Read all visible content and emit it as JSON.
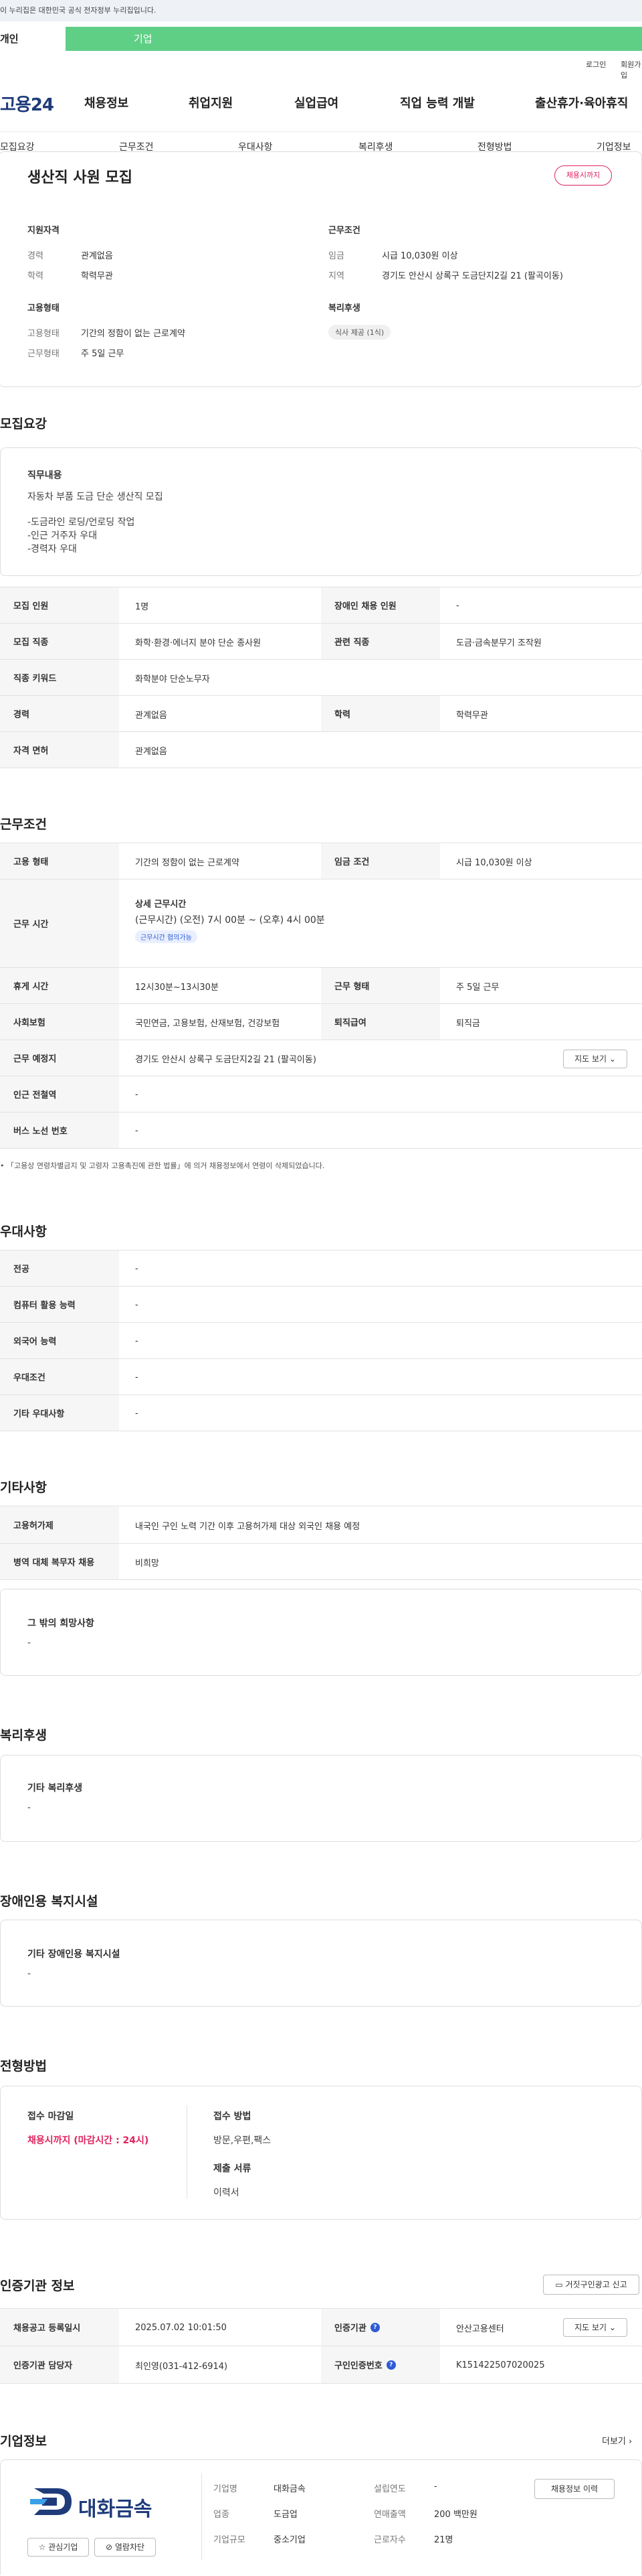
{
  "gov_bar": {
    "text": "이 누리집은 대한민국 공식 전자정부 누리집입니다."
  },
  "user_tabs": {
    "individual": "개인",
    "corporate": "기업"
  },
  "util": {
    "login": "로그인",
    "signup": "회원가입"
  },
  "gnb": {
    "logo": "고용24",
    "items": [
      "채용정보",
      "취업지원",
      "실업급여",
      "직업 능력 개발",
      "출산휴가·육아휴직",
      "기업정보"
    ]
  },
  "anchors": [
    "모집요강",
    "근무조건",
    "우대사항",
    "복리후생",
    "전형방법",
    "기업정보"
  ],
  "summary": {
    "title": "생산직 사원 모집",
    "deadline_badge": "채용시까지",
    "qual_head": "지원자격",
    "career_k": "경력",
    "career_v": "관계없음",
    "edu_k": "학력",
    "edu_v": "학력무관",
    "emp_head": "고용형태",
    "emptype_k": "고용형태",
    "emptype_v": "기간의 정함이 없는 근로계약",
    "worktype_k": "근무형태",
    "worktype_v": "주 5일 근무",
    "cond_head": "근무조건",
    "wage_k": "임금",
    "wage_v": "시급 10,030원 이상",
    "region_k": "지역",
    "region_v": "경기도 안산시 상록구 도금단지2길 21 (팔곡이동)",
    "welfare_head": "복리후생",
    "welfare_chip": "식사 제공 (1식)"
  },
  "recruit": {
    "heading": "모집요강",
    "duty_head": "직무내용",
    "duty_lines": [
      "자동차 부품 도금 단순 생산직 모집",
      "",
      "-도금라인 로딩/언로딩 작업",
      "-인근 거주자 우대",
      "-경력자 우대"
    ],
    "rows": {
      "headcount_k": "모집 인원",
      "headcount_v": "1명",
      "disabled_k": "장애인 채용 인원",
      "disabled_v": "-",
      "jobcat_k": "모집 직종",
      "jobcat_v": "화학·환경·에너지 분야 단순 종사원",
      "related_k": "관련 직종",
      "related_v": "도금·금속분무기 조작원",
      "keyword_k": "직종 키워드",
      "keyword_v": "화학분야 단순노무자",
      "career_k": "경력",
      "career_v": "관계없음",
      "edu_k": "학력",
      "edu_v": "학력무관",
      "license_k": "자격 면허",
      "license_v": "관계없음"
    }
  },
  "work": {
    "heading": "근무조건",
    "emptype_k": "고용 형태",
    "emptype_v": "기간의 정함이 없는 근로계약",
    "wage_k": "임금 조건",
    "wage_v": "시급 10,030원 이상",
    "hours_k": "근무 시간",
    "hours_title": "상세 근무시간",
    "hours_v": "(근무시간) (오전) 7시 00분 ~ (오후) 4시 00분",
    "hours_tag": "근무시간 협의가능",
    "break_k": "휴게 시간",
    "break_v": "12시30분~13시30분",
    "form_k": "근무 형태",
    "form_v": "주 5일 근무",
    "insurance_k": "사회보험",
    "insurance_v": "국민연금, 고용보험, 산재보험, 건강보험",
    "retire_k": "퇴직급여",
    "retire_v": "퇴직금",
    "place_k": "근무 예정지",
    "place_v": "경기도 안산시 상록구 도금단지2길 21 (팔곡이동)",
    "map_btn": "지도 보기",
    "subway_k": "인근 전철역",
    "subway_v": "-",
    "bus_k": "버스 노선 번호",
    "bus_v": "-",
    "note": "「고용상 연령차별금지 및 고령자 고용촉진에 관한 법률」에 의거 채용정보에서 연령이 삭제되었습니다."
  },
  "pref": {
    "heading": "우대사항",
    "major_k": "전공",
    "major_v": "-",
    "computer_k": "컴퓨터 활용 능력",
    "computer_v": "-",
    "lang_k": "외국어 능력",
    "lang_v": "-",
    "cond_k": "우대조건",
    "cond_v": "-",
    "other_k": "기타 우대사항",
    "other_v": "-"
  },
  "other": {
    "heading": "기타사항",
    "permit_k": "고용허가제",
    "permit_v": "내국인 구인 노력 기간 이후 고용허가제 대상 외국인 채용 예정",
    "military_k": "병역 대체 복무자 채용",
    "military_v": "비희망",
    "wish_head": "그 밖의 희망사항",
    "wish_v": "-"
  },
  "welfare": {
    "heading": "복리후생",
    "box_head": "기타 복리후생",
    "box_v": "-"
  },
  "disabled": {
    "heading": "장애인용 복지시설",
    "box_head": "기타 장애인용 복지시설",
    "box_v": "-"
  },
  "screening": {
    "heading": "전형방법",
    "deadline_head": "접수 마감일",
    "deadline_v": "채용시까지 (마감시간 : 24시)",
    "method_head": "접수 방법",
    "method_v": "방문,우편,팩스",
    "docs_head": "제출 서류",
    "docs_v": "이력서"
  },
  "agency": {
    "heading": "인증기관 정보",
    "report_btn": "거짓구인광고 신고",
    "reg_k": "채용공고 등록일시",
    "reg_v": "2025.07.02 10:01:50",
    "agency_k": "인증기관",
    "agency_v": "안산고용센터",
    "map_btn": "지도 보기",
    "manager_k": "인증기관 담당자",
    "manager_v": "최인영(031-412-6914)",
    "number_k": "구인인증번호",
    "number_v": "K151422507020025"
  },
  "company": {
    "heading": "기업정보",
    "more": "더보기",
    "logo_text": "대화금속",
    "name_k": "기업명",
    "name_v": "대화금속",
    "industry_k": "업종",
    "industry_v": "도금업",
    "size_k": "기업규모",
    "size_v": "중소기업",
    "founded_k": "설립연도",
    "founded_v": "-",
    "sales_k": "연매출액",
    "sales_v": "200 백만원",
    "staff_k": "근로자수",
    "staff_v": "21명",
    "history_btn": "채용정보 이력",
    "interest_btn": "관심기업",
    "alarm_btn": "열람차단"
  },
  "colors": {
    "accent_green": "#5fcf86",
    "accent_pink": "#e0245e",
    "brand_blue": "#1f3b7a",
    "info_blue": "#2d5bd6"
  }
}
